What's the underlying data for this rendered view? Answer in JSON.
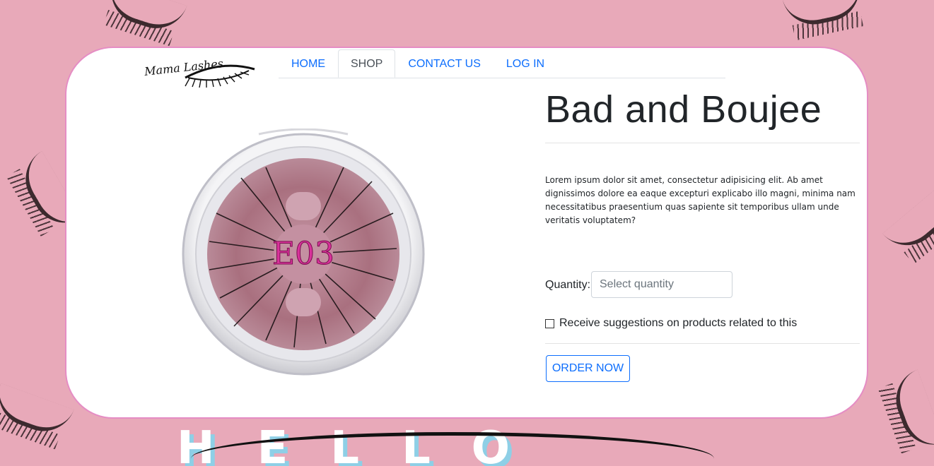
{
  "brand": {
    "logo_text": "Mama Lashes"
  },
  "nav": {
    "tabs": [
      {
        "label": "HOME",
        "active": false
      },
      {
        "label": "SHOP",
        "active": true
      },
      {
        "label": "CONTACT US",
        "active": false
      },
      {
        "label": "LOG IN",
        "active": false
      }
    ]
  },
  "product": {
    "image_label": "E03",
    "title": "Bad and Boujee",
    "description": "Lorem ipsum dolor sit amet, consectetur adipisicing elit. Ab amet dignissimos dolore ea eaque excepturi explicabo illo magni, minima nam necessitatibus praesentium quas sapiente sit temporibus ullam unde veritatis voluptatem?",
    "quantity_label": "Quantity:",
    "quantity_placeholder": "Select quantity",
    "suggestions_label": "Receive suggestions on products related to this",
    "order_button": "ORDER NOW"
  },
  "background": {
    "text": "HELLO"
  },
  "colors": {
    "accent": "#0d6efd",
    "card_border": "#e58dc4",
    "background_pink": "#e8a9b9"
  }
}
